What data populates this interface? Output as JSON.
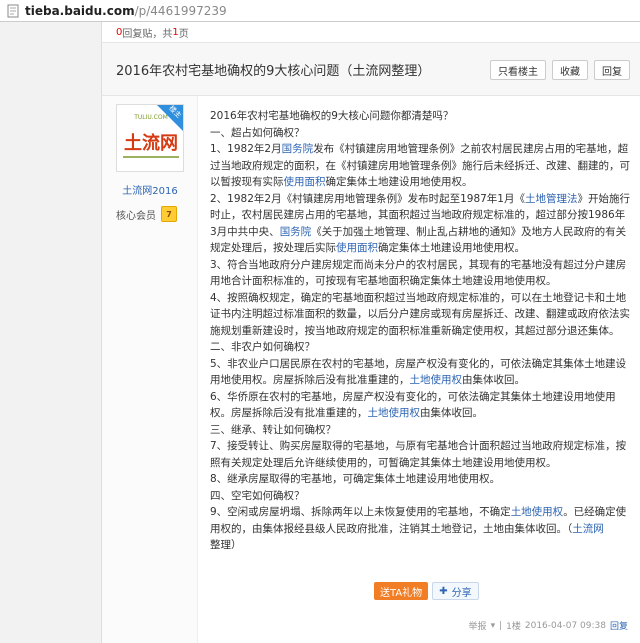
{
  "browser": {
    "url_host": "tieba.baidu.com",
    "url_path": "/p/4461997239"
  },
  "stats": {
    "reply_count": "0",
    "reply_label": "回复贴，共",
    "page_count": "1",
    "page_label": "页"
  },
  "thread": {
    "title": "2016年农村宅基地确权的9大核心问题（土流网整理）",
    "buttons": {
      "only_op": "只看楼主",
      "favorite": "收藏",
      "reply": "回复"
    }
  },
  "author": {
    "badge": "楼主",
    "logo_top": "TULIU.COM",
    "logo_main": "土流网",
    "name": "土流网2016",
    "member_label": "核心会员",
    "level": "7"
  },
  "content": {
    "lines": [
      "2016年农村宅基地确权的9大核心问题你都清楚吗？",
      "一、超占如何确权？",
      "二、非农户如何确权？",
      "三、继承、转让如何确权？",
      "四、空宅如何确权？"
    ],
    "p1_a": "1、1982年2月",
    "p1_link1": "国务院",
    "p1_b": "发布《村镇建房用地管理条例》之前农村居民建房占用的宅基地，超过当地政府规定的面积，在《村镇建房用地管理条例》施行后未经拆迁、改建、翻建的，可以暂按现有实际",
    "p1_link2": "使用面积",
    "p1_c": "确定集体土地建设用地使用权。",
    "p2_a": "2、1982年2月《村镇建房用地管理条例》发布时起至1987年1月《",
    "p2_link1": "土地管理法",
    "p2_b": "》开始施行时止，农村居民建房占用的宅基地，其面积超过当地政府规定标准的，超过部分按1986年3月中共中央、",
    "p2_link2": "国务院",
    "p2_c": "《关于加强土地管理、制止乱占耕地的通知》及地方人民政府的有关规定处理后，按处理后实际",
    "p2_link3": "使用面积",
    "p2_d": "确定集体土地建设用地使用权。",
    "p3": "3、符合当地政府分户建房规定而尚未分户的农村居民，其现有的宅基地没有超过分户建房用地合计面积标准的，可按现有宅基地面积确定集体土地建设用地使用权。",
    "p4": "4、按照确权规定，确定的宅基地面积超过当地政府规定标准的，可以在土地登记卡和土地证书内注明超过标准面积的数量，以后分户建房或现有房屋拆迁、改建、翻建或政府依法实施规划重新建设时，按当地政府规定的面积标准重新确定使用权，其超过部分退还集体。",
    "p5_a": "5、非农业户口居民原在农村的宅基地，房屋产权没有变化的，可依法确定其集体土地建设用地使用权。房屋拆除后没有批准重建的，",
    "p5_link": "土地使用权",
    "p5_b": "由集体收回。",
    "p6_a": "6、华侨原在农村的宅基地，房屋产权没有变化的，可依法确定其集体土地建设用地使用权。房屋拆除后没有批准重建的，",
    "p6_link": "土地使用权",
    "p6_b": "由集体收回。",
    "p7": "7、接受转让、购买房屋取得的宅基地，与原有宅基地合计面积超过当地政府规定标准，按照有关规定处理后允许继续使用的，可暂确定其集体土地建设用地使用权。",
    "p8": "8、继承房屋取得的宅基地，可确定集体土地建设用地使用权。",
    "p9_a": "9、空闲或房屋坍塌、拆除两年以上未恢复使用的宅基地，不确定",
    "p9_link1": "土地使用权",
    "p9_b": "。已经确定使用权的，由集体报经县级人民政府批准，注销其土地登记，土地由集体收回。（",
    "p9_link2": "土流网",
    "p9_c": "整理）"
  },
  "actions": {
    "gift": "送TA礼物",
    "share": "分享"
  },
  "footer": {
    "report": "举报",
    "floor": "1楼",
    "datetime": "2016-04-07 09:38",
    "reply": "回复"
  },
  "colors": {
    "link": "#2d64b3",
    "accent_red": "#e10602",
    "gift_orange": "#f17d24",
    "badge_blue": "#2f8fde",
    "logo_red": "#d43b12"
  }
}
